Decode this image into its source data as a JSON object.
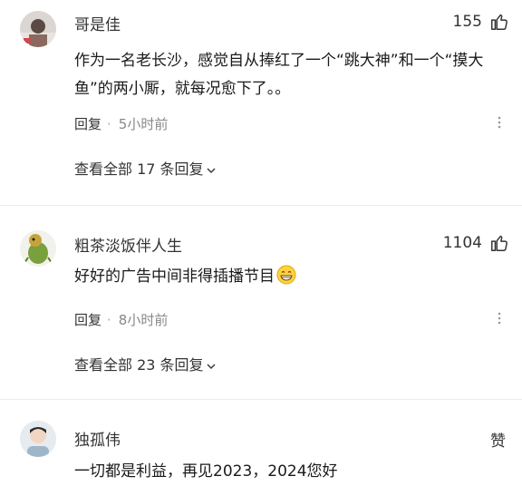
{
  "comments": [
    {
      "user": "哥是佳",
      "likes": "155",
      "text": "作为一名老长沙，感觉自从捧红了一个“跳大神”和一个“摸大鱼”的两小厮，就每况愈下了。。",
      "reply_label": "回复",
      "time": "5小时前",
      "expand": "查看全部 17 条回复"
    },
    {
      "user": "粗茶淡饭伴人生",
      "likes": "1104",
      "text": "好好的广告中间非得插播节目",
      "reply_label": "回复",
      "time": "8小时前",
      "expand": "查看全部 23 条回复"
    },
    {
      "user": "独孤伟",
      "likes": "赞",
      "text": "一切都是利益，再见2023，2024您好"
    }
  ],
  "icons": {
    "like": "thumbs-up-icon",
    "more": "more-dots-icon",
    "emoji": "grin-emoji-icon"
  }
}
